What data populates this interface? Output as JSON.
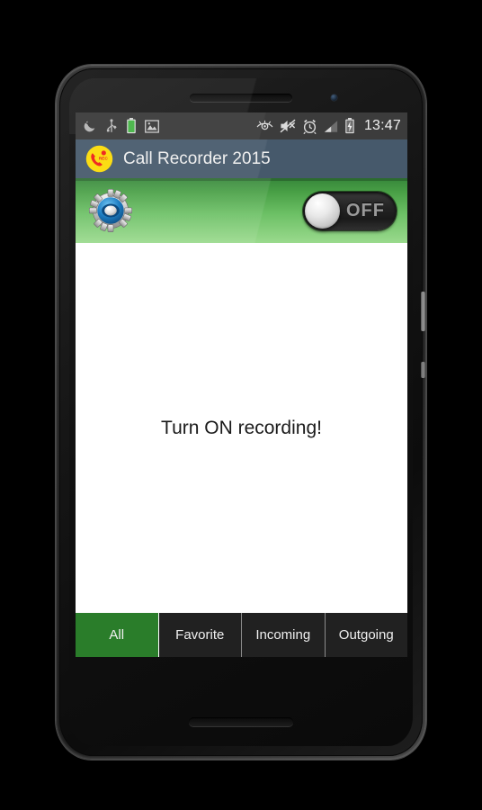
{
  "device": {
    "name": "android-smartphone-mockup",
    "frame_color": "#2b2b2b"
  },
  "status_bar": {
    "background": "#3c3c3c",
    "time": "13:47",
    "left_icons": [
      {
        "name": "moon-do-not-disturb-icon",
        "glyph": "moon"
      },
      {
        "name": "usb-icon",
        "glyph": "usb"
      },
      {
        "name": "battery-notification-icon",
        "glyph": "battery"
      },
      {
        "name": "screenshot-image-icon",
        "glyph": "image"
      }
    ],
    "right_icons": [
      {
        "name": "eye-visibility-icon",
        "glyph": "eye"
      },
      {
        "name": "volume-muted-icon",
        "glyph": "speaker-muted"
      },
      {
        "name": "alarm-clock-icon",
        "glyph": "alarm"
      },
      {
        "name": "signal-bars-icon",
        "glyph": "signal"
      },
      {
        "name": "battery-charging-icon",
        "glyph": "battery-bolt"
      }
    ]
  },
  "title_bar": {
    "background": "#46596b",
    "app_name": "Call Recorder 2015",
    "app_icon": "call-recorder-rec-icon",
    "app_icon_label": "REC"
  },
  "control_bar": {
    "background_top": "#36863a",
    "background_bottom": "#9ada8d",
    "settings_icon": "gear-eye-settings-icon",
    "toggle": {
      "name": "recording-toggle",
      "state": "off",
      "label": "OFF"
    }
  },
  "content": {
    "background": "#ffffff",
    "empty_message": "Turn ON recording!"
  },
  "tab_bar": {
    "active_color": "#2a7d2a",
    "inactive_color": "#212121",
    "active_index": 0,
    "tabs": [
      {
        "id": "all",
        "label": "All"
      },
      {
        "id": "favorite",
        "label": "Favorite"
      },
      {
        "id": "incoming",
        "label": "Incoming"
      },
      {
        "id": "outgoing",
        "label": "Outgoing"
      }
    ]
  }
}
